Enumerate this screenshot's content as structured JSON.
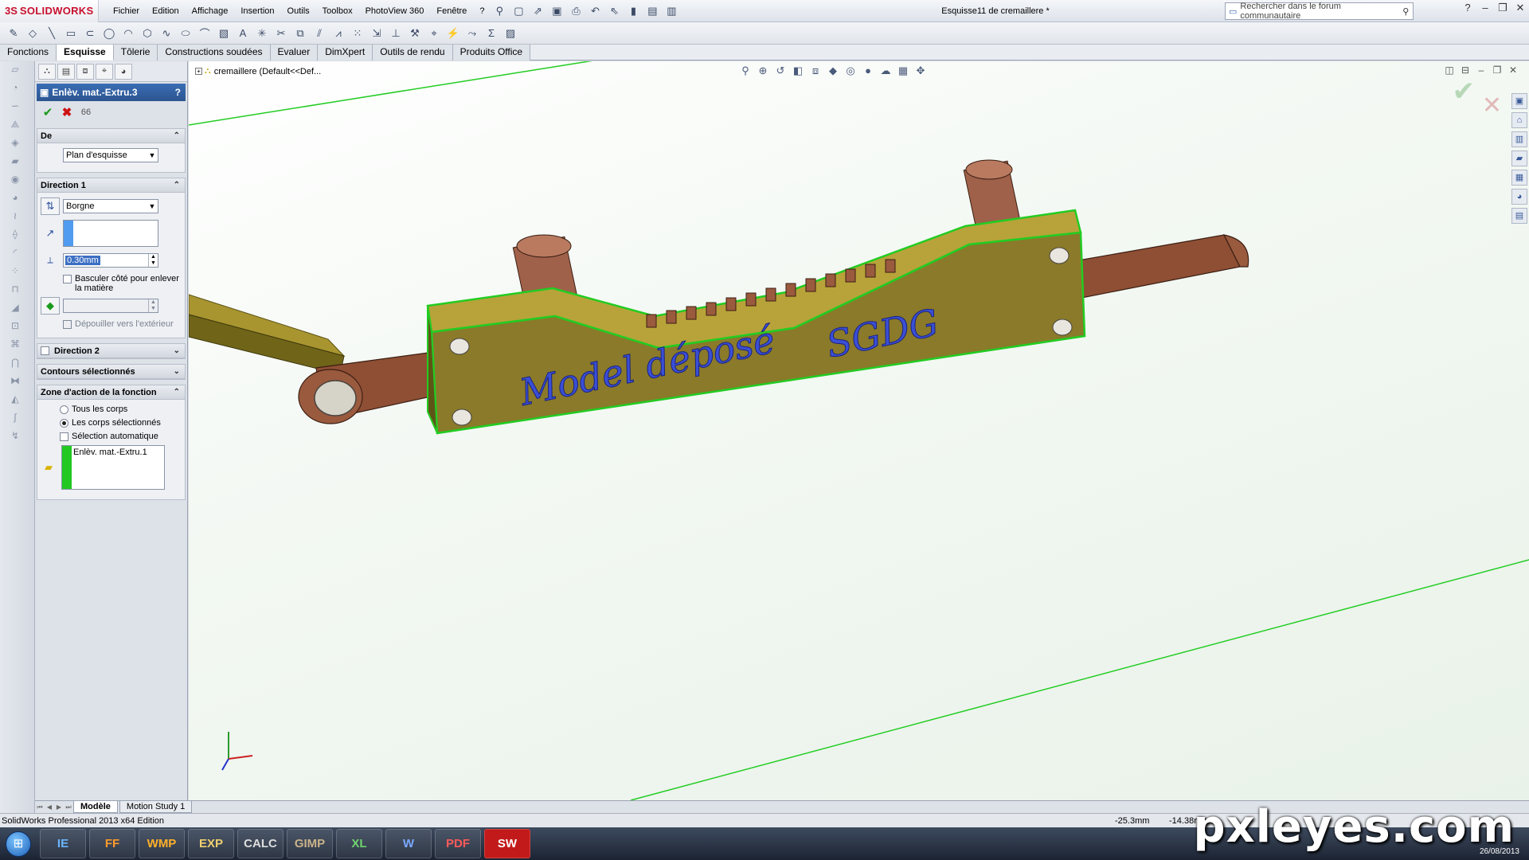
{
  "app": {
    "logo_ds": "3S",
    "logo_name": "SOLIDWORKS",
    "document_title": "Esquisse11 de cremaillere *",
    "search_placeholder": "Rechercher dans le forum communautaire"
  },
  "menu": [
    "Fichier",
    "Edition",
    "Affichage",
    "Insertion",
    "Outils",
    "Toolbox",
    "PhotoView 360",
    "Fenêtre",
    "?"
  ],
  "command_tabs": [
    {
      "label": "Fonctions",
      "active": false
    },
    {
      "label": "Esquisse",
      "active": true
    },
    {
      "label": "Tôlerie",
      "active": false
    },
    {
      "label": "Constructions soudées",
      "active": false
    },
    {
      "label": "Evaluer",
      "active": false
    },
    {
      "label": "DimXpert",
      "active": false
    },
    {
      "label": "Outils de rendu",
      "active": false
    },
    {
      "label": "Produits Office",
      "active": false
    }
  ],
  "property_manager": {
    "title": "Enlèv. mat.-Extru.3",
    "help": "?",
    "ok_icon": "✔",
    "cancel_icon": "✖",
    "preview_icon": "66",
    "from": {
      "title": "De",
      "value": "Plan d'esquisse"
    },
    "direction1": {
      "title": "Direction 1",
      "end_condition": "Borgne",
      "depth": "0.30mm",
      "flip_side_label": "Basculer côté pour enlever la matière",
      "draft_outward_label": "Dépouiller vers l'extérieur"
    },
    "direction2": {
      "title": "Direction 2"
    },
    "selected_contours": {
      "title": "Contours sélectionnés"
    },
    "feature_scope": {
      "title": "Zone d'action de la fonction",
      "all_bodies": "Tous les corps",
      "selected_bodies": "Les corps sélectionnés",
      "auto_select": "Sélection automatique",
      "body_item": "Enlèv. mat.-Extru.1"
    }
  },
  "viewport": {
    "tree_item": "cremaillere  (Default<<Def...",
    "text_model": "Model déposé",
    "text_brand": "SGDG"
  },
  "bottom_tabs": [
    {
      "label": "Modèle",
      "active": true
    },
    {
      "label": "Motion Study 1",
      "active": false
    }
  ],
  "status": {
    "product": "SolidWorks Professional 2013 x64 Edition",
    "x": "-25.3mm",
    "y": "-14.38mm"
  },
  "taskbar": {
    "apps": [
      "IE",
      "FF",
      "WMP",
      "EXP",
      "CALC",
      "GIMP",
      "XL",
      "W",
      "PDF",
      "SW"
    ],
    "date": "26/08/2013"
  },
  "watermark": "pxleyes.com",
  "colors": {
    "part_olive": "#8a7a2a",
    "part_green_edge": "#22cc22",
    "link_brown": "#9a5a3e",
    "text_blue": "#3b4fd6",
    "selection_blue": "#3b6fc3"
  }
}
